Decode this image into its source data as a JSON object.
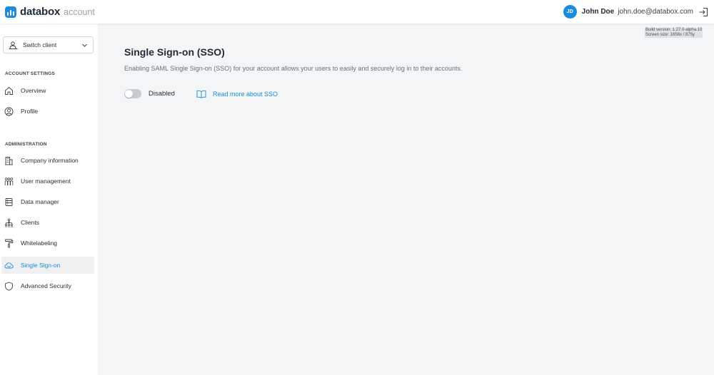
{
  "header": {
    "brand_name": "databox",
    "brand_sub": "account",
    "user_initials": "JD",
    "user_name": "John Doe",
    "user_email": "john.doe@databox.com"
  },
  "build_info": {
    "version": "Build version: 1.27.0-alpha.10",
    "screen": "Screen size: 1656x / 875y"
  },
  "sidebar": {
    "switch_client_label": "Switch client",
    "sections": [
      {
        "title": "ACCOUNT SETTINGS"
      },
      {
        "title": "ADMINISTRATION"
      }
    ],
    "items": [
      {
        "label": "Overview",
        "icon": "home-icon"
      },
      {
        "label": "Profile",
        "icon": "profile-icon"
      },
      {
        "label": "Company information",
        "icon": "building-icon"
      },
      {
        "label": "User management",
        "icon": "users-icon"
      },
      {
        "label": "Data manager",
        "icon": "database-icon"
      },
      {
        "label": "Clients",
        "icon": "hierarchy-icon"
      },
      {
        "label": "Whitelabeling",
        "icon": "paint-roller-icon"
      },
      {
        "label": "Single Sign-on",
        "icon": "cloud-icon",
        "active": true
      },
      {
        "label": "Advanced Security",
        "icon": "shield-icon"
      }
    ]
  },
  "main": {
    "title": "Single Sign-on (SSO)",
    "description": "Enabling SAML Single Sign-on (SSO) for your account allows your users to easily and securely log in to their accounts.",
    "toggle_state": "off",
    "toggle_label": "Disabled",
    "read_more_label": "Read more about SSO"
  },
  "colors": {
    "accent": "#1a8cd8",
    "background": "#f4f5f6",
    "sidebar": "#ffffff",
    "toggle_off": "#c7ccd1"
  }
}
